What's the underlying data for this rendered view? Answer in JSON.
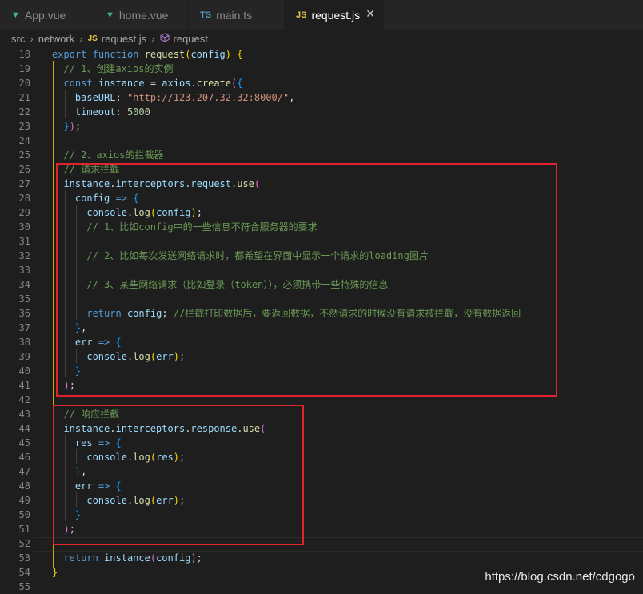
{
  "tabs": [
    {
      "label": "App.vue",
      "icon": "vue-icon",
      "icon_text": "▼"
    },
    {
      "label": "home.vue",
      "icon": "vue-icon",
      "icon_text": "▼"
    },
    {
      "label": "main.ts",
      "icon": "typescript-icon",
      "icon_text": "TS"
    },
    {
      "label": "request.js",
      "icon": "javascript-icon",
      "icon_text": "JS",
      "active": true
    }
  ],
  "breadcrumb": {
    "items": [
      "src",
      "network",
      "request.js",
      "request"
    ],
    "file_icon_text": "JS"
  },
  "colors": {
    "editor_bg": "#1e1e1e",
    "keyword": "#569cd6",
    "function": "#dcdcaa",
    "comment": "#6a9955",
    "string": "#ce9178",
    "number": "#b5cea8",
    "highlight_box": "#e0242e"
  },
  "code_lines": [
    {
      "n": "18",
      "html": "<span class=\"kw\">export</span> <span class=\"kw\">function</span> <span class=\"fn\">request</span><span class=\"b1\">(</span><span class=\"pm\">config</span><span class=\"b1\">)</span> <span class=\"b1\">{</span>"
    },
    {
      "n": "19",
      "html": "  <span class=\"cm\">// 1、创建axios的实例</span>"
    },
    {
      "n": "20",
      "html": "  <span class=\"kw\">const</span> <span class=\"pm\">instance</span> = <span class=\"pm\">axios</span>.<span class=\"fn\">create</span><span class=\"b2\">(</span><span class=\"b3\">{</span>"
    },
    {
      "n": "21",
      "html": "    <span class=\"pm\">baseURL</span>: <span class=\"st\">\"http://123.207.32.32:8000/\"</span>,"
    },
    {
      "n": "22",
      "html": "    <span class=\"pm\">timeout</span>: <span class=\"nm\">5000</span>"
    },
    {
      "n": "23",
      "html": "  <span class=\"b3\">}</span><span class=\"b2\">)</span>;"
    },
    {
      "n": "24",
      "html": ""
    },
    {
      "n": "25",
      "html": "  <span class=\"cm\">// 2、axios的拦截器</span>"
    },
    {
      "n": "26",
      "html": "  <span class=\"cm\">// 请求拦截</span>"
    },
    {
      "n": "27",
      "html": "  <span class=\"pm\">instance</span>.<span class=\"pm\">interceptors</span>.<span class=\"pm\">request</span>.<span class=\"fn\">use</span><span class=\"b2\">(</span>"
    },
    {
      "n": "28",
      "html": "    <span class=\"pm\">config</span> <span class=\"kw\">=&gt;</span> <span class=\"b3\">{</span>"
    },
    {
      "n": "29",
      "html": "      <span class=\"pm\">console</span>.<span class=\"fn\">log</span><span class=\"b1\">(</span><span class=\"pm\">config</span><span class=\"b1\">)</span>;"
    },
    {
      "n": "30",
      "html": "      <span class=\"cm\">// 1、比如config中的一些信息不符合服务器的要求</span>"
    },
    {
      "n": "31",
      "html": ""
    },
    {
      "n": "32",
      "html": "      <span class=\"cm\">// 2、比如每次发送网络请求时，都希望在界面中显示一个请求的loading图片</span>"
    },
    {
      "n": "33",
      "html": ""
    },
    {
      "n": "34",
      "html": "      <span class=\"cm\">// 3、某些网络请求（比如登录（token）），必须携带一些特殊的信息</span>"
    },
    {
      "n": "35",
      "html": ""
    },
    {
      "n": "36",
      "html": "      <span class=\"kw\">return</span> <span class=\"pm\">config</span>; <span class=\"cm\">//拦截打印数据后，要返回数据，不然请求的时候没有请求被拦截，没有数据返回</span>"
    },
    {
      "n": "37",
      "html": "    <span class=\"b3\">}</span>,"
    },
    {
      "n": "38",
      "html": "    <span class=\"pm\">err</span> <span class=\"kw\">=&gt;</span> <span class=\"b3\">{</span>"
    },
    {
      "n": "39",
      "html": "      <span class=\"pm\">console</span>.<span class=\"fn\">log</span><span class=\"b1\">(</span><span class=\"pm\">err</span><span class=\"b1\">)</span>;"
    },
    {
      "n": "40",
      "html": "    <span class=\"b3\">}</span>"
    },
    {
      "n": "41",
      "html": "  <span class=\"b2\">)</span>;"
    },
    {
      "n": "42",
      "html": ""
    },
    {
      "n": "43",
      "html": "  <span class=\"cm\">// 响应拦截</span>"
    },
    {
      "n": "44",
      "html": "  <span class=\"pm\">instance</span>.<span class=\"pm\">interceptors</span>.<span class=\"pm\">response</span>.<span class=\"fn\">use</span><span class=\"b2\">(</span>"
    },
    {
      "n": "45",
      "html": "    <span class=\"pm\">res</span> <span class=\"kw\">=&gt;</span> <span class=\"b3\">{</span>"
    },
    {
      "n": "46",
      "html": "      <span class=\"pm\">console</span>.<span class=\"fn\">log</span><span class=\"b1\">(</span><span class=\"pm\">res</span><span class=\"b1\">)</span>;"
    },
    {
      "n": "47",
      "html": "    <span class=\"b3\">}</span>,"
    },
    {
      "n": "48",
      "html": "    <span class=\"pm\">err</span> <span class=\"kw\">=&gt;</span> <span class=\"b3\">{</span>"
    },
    {
      "n": "49",
      "html": "      <span class=\"pm\">console</span>.<span class=\"fn\">log</span><span class=\"b1\">(</span><span class=\"pm\">err</span><span class=\"b1\">)</span>;"
    },
    {
      "n": "50",
      "html": "    <span class=\"b3\">}</span>"
    },
    {
      "n": "51",
      "html": "  <span class=\"b2\">)</span>;"
    },
    {
      "n": "52",
      "html": ""
    },
    {
      "n": "53",
      "html": "  <span class=\"kw\">return</span> <span class=\"pm\">instance</span><span class=\"b2\">(</span><span class=\"pm\">config</span><span class=\"b2\">)</span>;"
    },
    {
      "n": "54",
      "html": "<span class=\"b1\">}</span>"
    },
    {
      "n": "55",
      "html": ""
    }
  ],
  "watermark": "https://blog.csdn.net/cdgogo"
}
